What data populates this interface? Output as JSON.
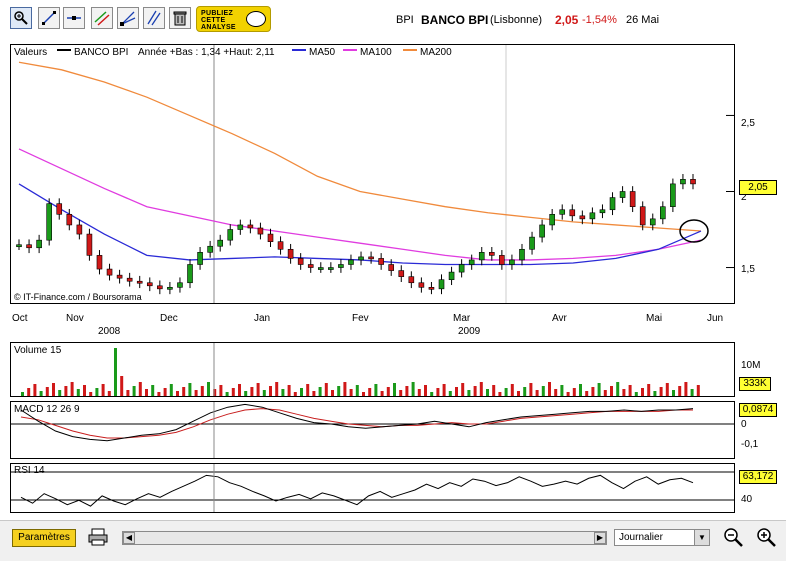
{
  "toolbar": {
    "ad_line1": "PUBLIEZ",
    "ad_line2": "CETTE",
    "ad_line3": "ANALYSE"
  },
  "header": {
    "ticker": "BPI",
    "name": "BANCO BPI",
    "exchange": "(Lisbonne)",
    "price": "2,05",
    "change": "-1,54%",
    "date": "26 Mai"
  },
  "legend": {
    "valeurs": "Valeurs",
    "series_name": "BANCO BPI",
    "range": "Année +Bas : 1,34 +Haut: 2,11",
    "ma50": "MA50",
    "ma100": "MA100",
    "ma200": "MA200"
  },
  "colors": {
    "ma50": "#2a2ad6",
    "ma100": "#e03ce0",
    "ma200": "#f08a3c",
    "up": "#1a9a1a",
    "down": "#d01818",
    "macd_signal": "#c81e1e"
  },
  "credit": "© IT-Finance.com / Boursorama",
  "price_axis": [
    "2,5",
    "2",
    "1,5"
  ],
  "current_price_box": "2,05",
  "months": [
    "Oct",
    "Nov",
    "Dec",
    "Jan",
    "Fev",
    "Mar",
    "Avr",
    "Mai",
    "Jun"
  ],
  "years": [
    "2008",
    "2009"
  ],
  "volume": {
    "label": "Volume 15",
    "axis": "10M",
    "box": "333K"
  },
  "macd": {
    "label": "MACD 12 26 9",
    "box": "0,0874",
    "zero": "0",
    "neg": "-0,1"
  },
  "rsi": {
    "label": "RSI 14",
    "box": "63,172",
    "level": "40"
  },
  "bottom": {
    "params": "Paramètres",
    "period": "Journalier"
  },
  "chart_data": {
    "type": "candlestick",
    "title": "BANCO BPI",
    "xlabel": "",
    "ylabel": "",
    "ylim": [
      1.28,
      2.95
    ],
    "x_months": [
      "Oct 2008",
      "Nov 2008",
      "Dec 2008",
      "Jan 2009",
      "Fev 2009",
      "Mar 2009",
      "Avr 2009",
      "Mai 2009",
      "Jun 2009"
    ],
    "close_trace": [
      1.65,
      1.63,
      1.68,
      1.92,
      1.85,
      1.78,
      1.72,
      1.58,
      1.49,
      1.45,
      1.43,
      1.41,
      1.4,
      1.38,
      1.36,
      1.37,
      1.4,
      1.52,
      1.6,
      1.64,
      1.68,
      1.75,
      1.78,
      1.76,
      1.72,
      1.67,
      1.62,
      1.56,
      1.52,
      1.5,
      1.5,
      1.5,
      1.52,
      1.55,
      1.57,
      1.56,
      1.52,
      1.48,
      1.44,
      1.4,
      1.37,
      1.36,
      1.42,
      1.47,
      1.52,
      1.55,
      1.6,
      1.58,
      1.52,
      1.55,
      1.62,
      1.7,
      1.78,
      1.85,
      1.88,
      1.84,
      1.82,
      1.86,
      1.88,
      1.96,
      2.0,
      1.9,
      1.78,
      1.82,
      1.9,
      2.05,
      2.08,
      2.05
    ],
    "series": [
      {
        "name": "MA200",
        "values": [
          2.85,
          2.8,
          2.72,
          2.62,
          2.5,
          2.38,
          2.25,
          2.1,
          2.0,
          1.95,
          1.9,
          1.86,
          1.83,
          1.8,
          1.78,
          1.76,
          1.74
        ]
      },
      {
        "name": "MA100",
        "values": [
          2.28,
          2.15,
          2.02,
          1.9,
          1.84,
          1.78,
          1.74,
          1.7,
          1.66,
          1.62,
          1.58,
          1.55,
          1.55,
          1.56,
          1.58,
          1.62,
          1.68
        ]
      },
      {
        "name": "MA50",
        "values": [
          2.05,
          1.88,
          1.72,
          1.58,
          1.55,
          1.56,
          1.57,
          1.56,
          1.55,
          1.53,
          1.52,
          1.52,
          1.52,
          1.53,
          1.56,
          1.62,
          1.74
        ]
      }
    ],
    "volume_current": "333K",
    "macd_current": 0.0874,
    "rsi_current": 63.172
  }
}
